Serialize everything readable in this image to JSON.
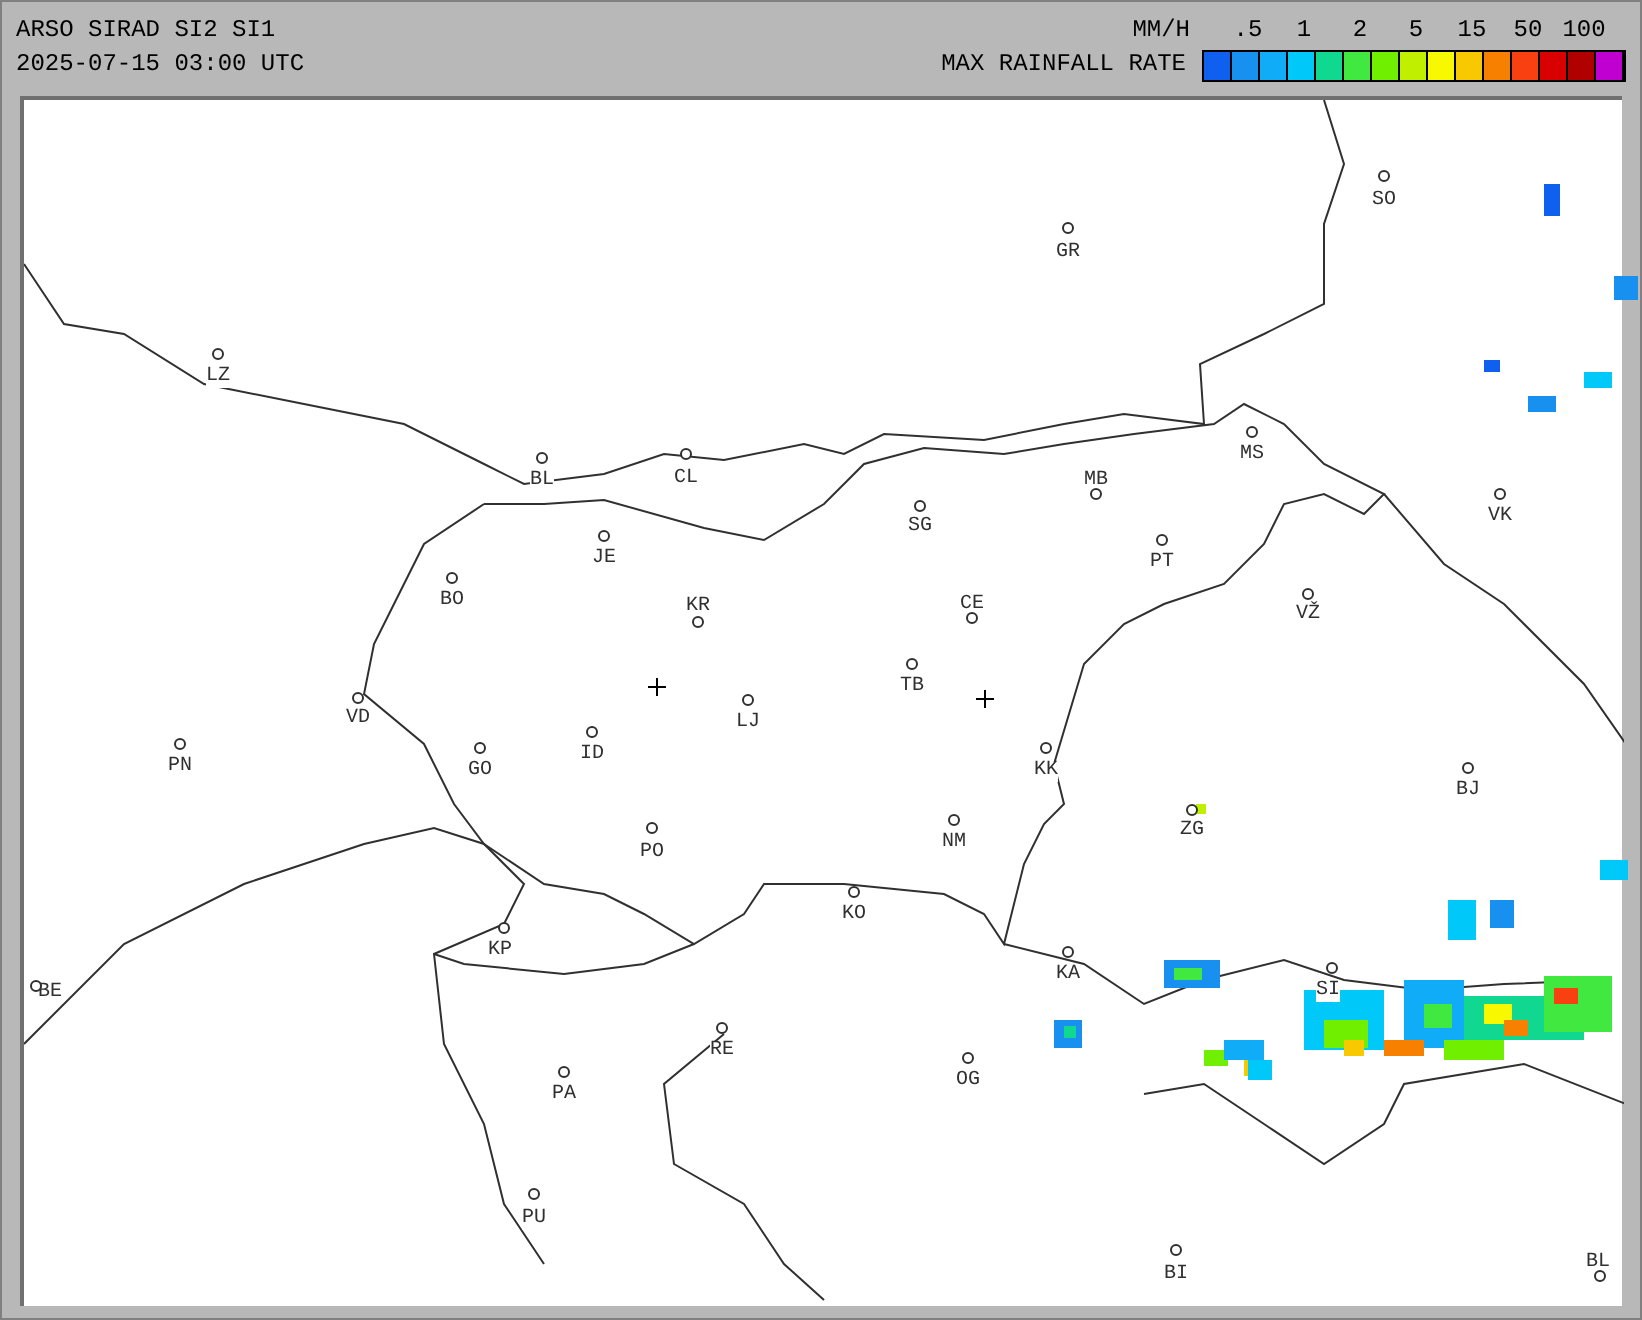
{
  "header": {
    "title": "ARSO SIRAD SI2 SI1",
    "timestamp": "2025-07-15 03:00 UTC"
  },
  "legend": {
    "unit": "MM/H",
    "title": "MAX RAINFALL RATE",
    "ticks": [
      ".5",
      "1",
      "2",
      "5",
      "15",
      "50",
      "100"
    ],
    "bins": [
      {
        "color": "#1060f0"
      },
      {
        "color": "#1890f0"
      },
      {
        "color": "#10acf8"
      },
      {
        "color": "#00c8f8"
      },
      {
        "color": "#10d890"
      },
      {
        "color": "#40e840"
      },
      {
        "color": "#70f000"
      },
      {
        "color": "#c0f000"
      },
      {
        "color": "#f8f800"
      },
      {
        "color": "#f8c800"
      },
      {
        "color": "#f88000"
      },
      {
        "color": "#f84010"
      },
      {
        "color": "#d80000"
      },
      {
        "color": "#b00000"
      },
      {
        "color": "#c000d0"
      }
    ]
  },
  "cities": [
    "LZ",
    "BL",
    "CL",
    "GR",
    "SO",
    "MS",
    "MB",
    "SG",
    "JE",
    "BO",
    "KR",
    "CE",
    "PT",
    "VŽ",
    "VK",
    "TB",
    "LJ",
    "VD",
    "PN",
    "ID",
    "GO",
    "KK",
    "BJ",
    "ZG",
    "PO",
    "NM",
    "KO",
    "KP",
    "KA",
    "SI",
    "BE",
    "RE",
    "OG",
    "PA",
    "PU",
    "BI",
    "BL"
  ]
}
